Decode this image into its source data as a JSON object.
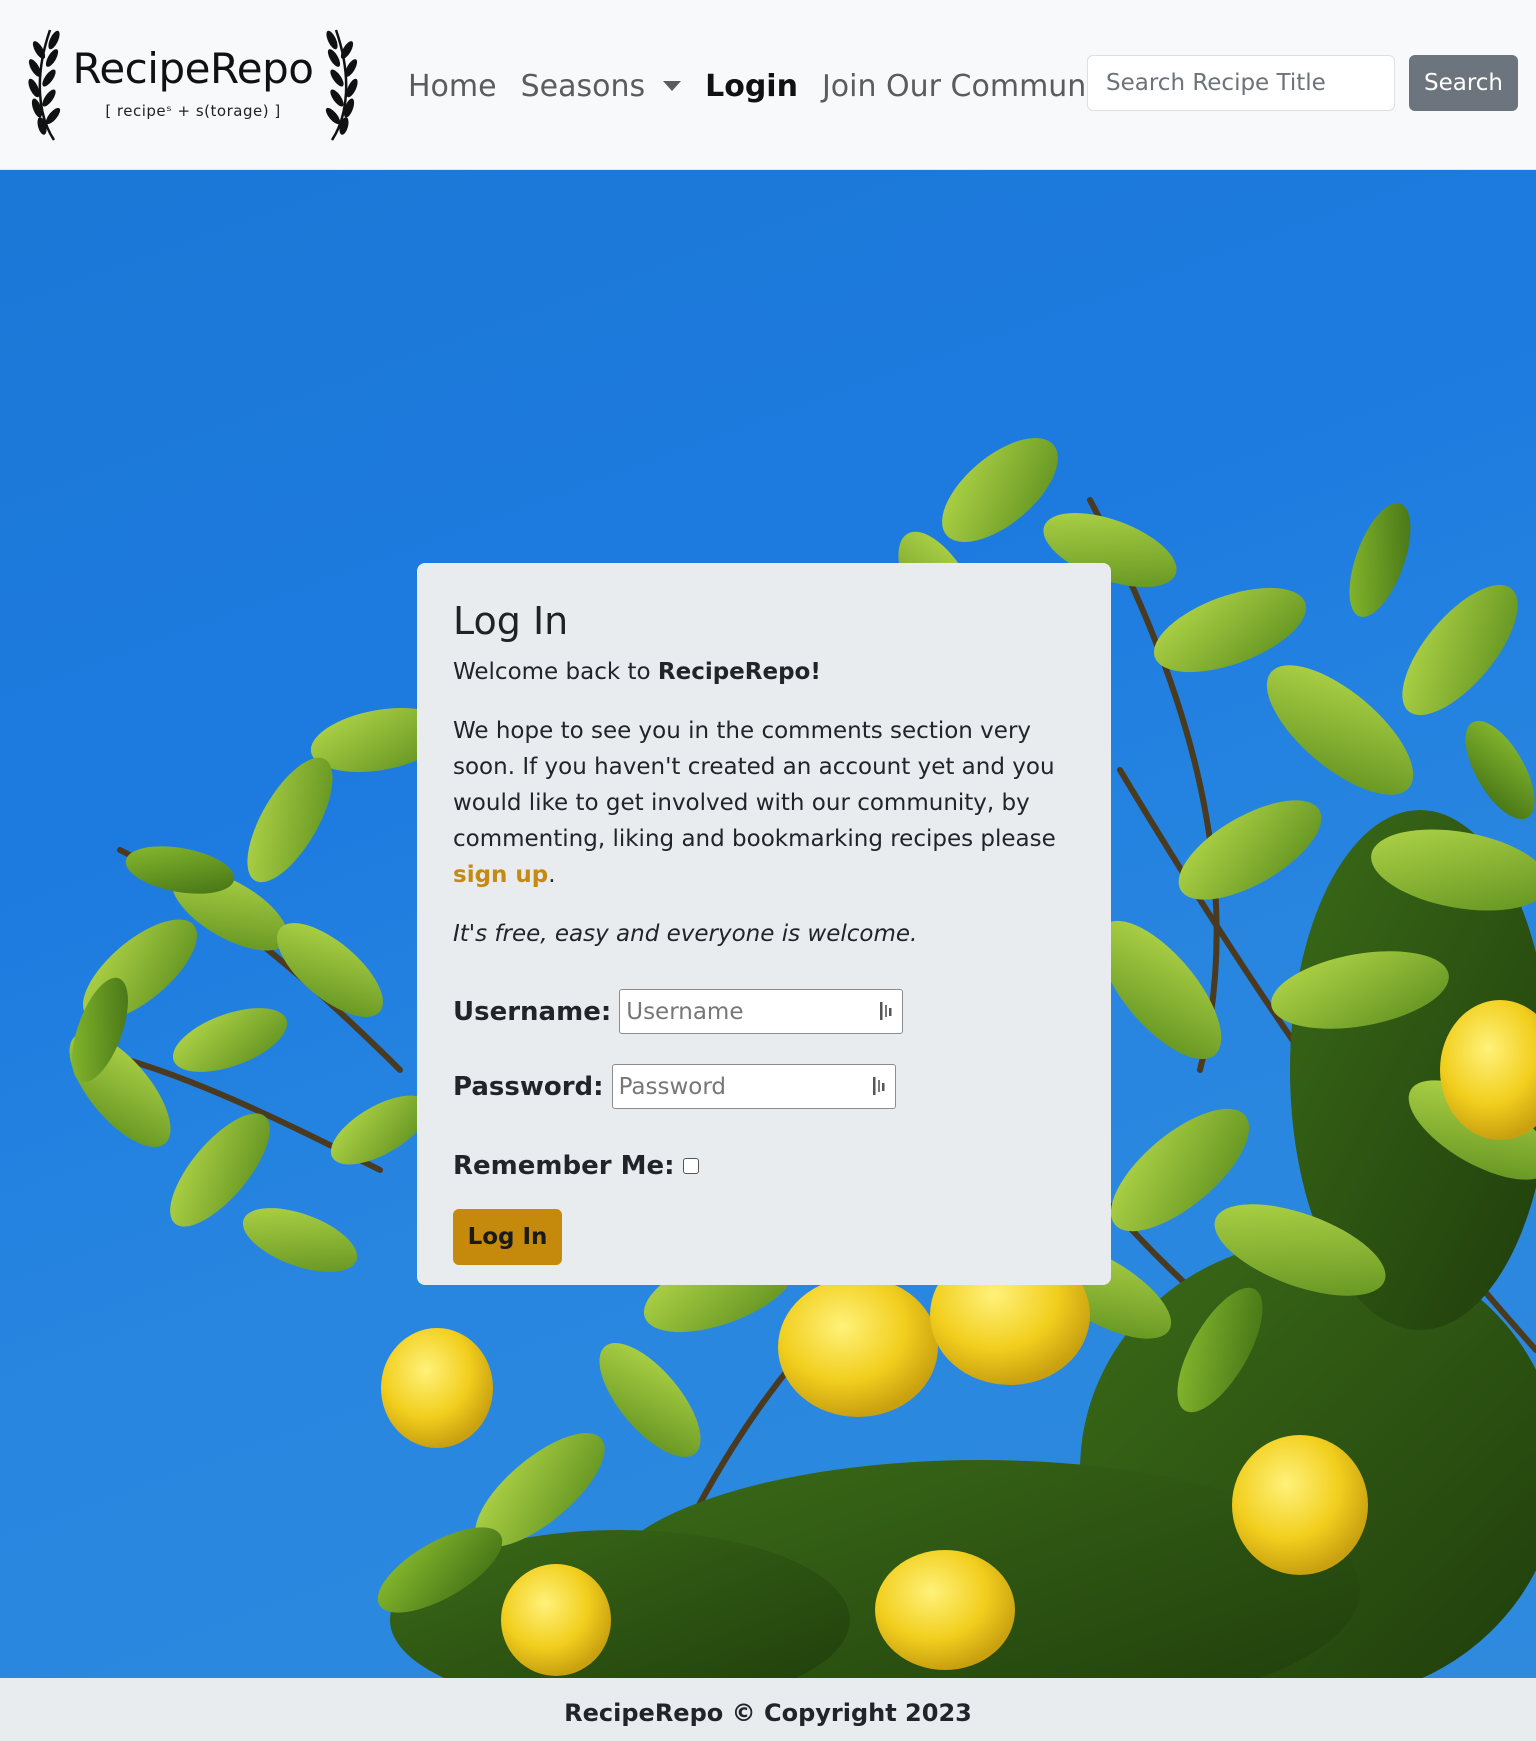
{
  "brand": {
    "name": "RecipeRepo",
    "tagline": "[ recipeˢ + s(torage) ]"
  },
  "nav": {
    "home": "Home",
    "seasons": "Seasons",
    "login": "Login",
    "join": "Join Our Community"
  },
  "search": {
    "placeholder": "Search Recipe Title",
    "button": "Search"
  },
  "login_card": {
    "title": "Log In",
    "welcome_prefix": "Welcome back to ",
    "welcome_brand": "RecipeRepo!",
    "intro_text": "We hope to see you in the comments section very soon. If you haven't created an account yet and you would like to get involved with our community, by commenting, liking and bookmarking recipes please ",
    "signup_link": "sign up",
    "intro_end": ".",
    "free_text": "It's free, easy and everyone is welcome.",
    "username_label": "Username:",
    "username_placeholder": "Username",
    "password_label": "Password:",
    "password_placeholder": "Password",
    "remember_label": "Remember Me:",
    "remember_checked": false,
    "submit": "Log In"
  },
  "footer": {
    "text": "RecipeRepo © Copyright 2023"
  },
  "colors": {
    "accent": "#c58a0c",
    "sky": "#1d7be0",
    "navbar_bg": "#f8f9fa",
    "card_bg": "#e9ecef",
    "search_button": "#6c757d"
  },
  "icons": {
    "brand_left": "laurel-left-icon",
    "brand_right": "laurel-right-icon",
    "seasons_dropdown": "caret-down-icon",
    "password_manager": "password-manager-icon"
  }
}
